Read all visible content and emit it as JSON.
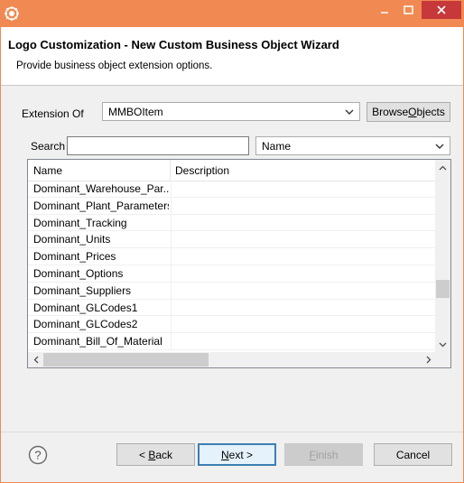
{
  "window": {
    "title": ""
  },
  "wizard": {
    "title": "Logo Customization - New Custom Business Object Wizard",
    "description": "Provide business object extension options."
  },
  "extension": {
    "label": "Extension Of",
    "value": "MMBOItem",
    "browse_button": "Browse Objects",
    "browse_mnemonic_pre": "Browse ",
    "browse_mnemonic_key": "O",
    "browse_mnemonic_post": "bjects"
  },
  "search": {
    "label": "Search",
    "value": "",
    "field_value": "Name"
  },
  "table": {
    "columns": [
      "Name",
      "Description"
    ],
    "rows": [
      "Dominant_Warehouse_Par...",
      "Dominant_Plant_Parameters",
      "Dominant_Tracking",
      "Dominant_Units",
      "Dominant_Prices",
      "Dominant_Options",
      "Dominant_Suppliers",
      "Dominant_GLCodes1",
      "Dominant_GLCodes2",
      "Dominant_Bill_Of_Material"
    ]
  },
  "buttons": {
    "back_pre": "< ",
    "back_key": "B",
    "back_post": "ack",
    "next_key": "N",
    "next_post": "ext >",
    "finish_key": "F",
    "finish_post": "inish",
    "cancel": "Cancel"
  },
  "colors": {
    "titlebar": "#f08a52",
    "close": "#c7383a",
    "default_button_border": "#3c7fb1"
  }
}
